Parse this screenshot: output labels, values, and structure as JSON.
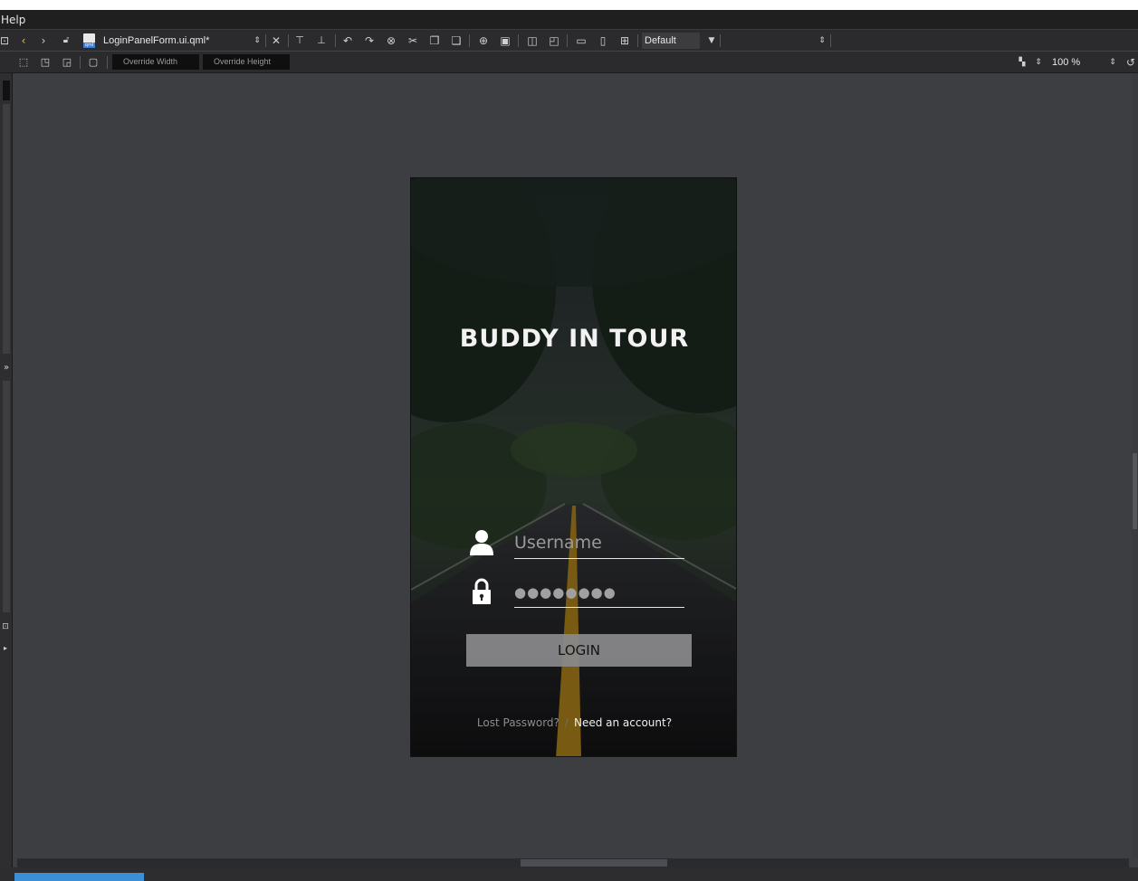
{
  "menu": {
    "help_label": "Help"
  },
  "toolbar": {
    "file_name": "LoginPanelForm.ui.qml*",
    "style_combo": "Default",
    "override_width": "Override Width",
    "override_height": "Override Height",
    "zoom": "100 %"
  },
  "form": {
    "title": "BUDDY IN TOUR",
    "username_placeholder": "Username",
    "password_value": "●●●●●●●●",
    "login_label": "LOGIN",
    "lost_password": "Lost Password?",
    "separator": "/",
    "need_account": "Need an account?"
  }
}
